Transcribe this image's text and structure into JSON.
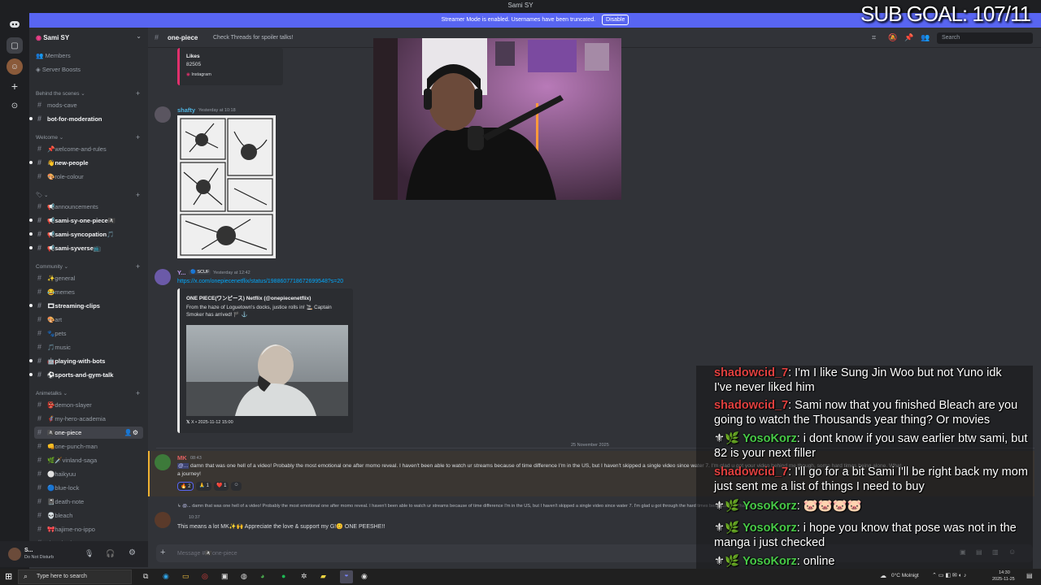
{
  "window": {
    "title": "Sami SY"
  },
  "banner": {
    "text": "Streamer Mode is enabled. Usernames have been truncated.",
    "disable_label": "Disable"
  },
  "overlay": {
    "sub_goal": "SUB GOAL: 107/11"
  },
  "server": {
    "name": "Sami SY"
  },
  "nav": {
    "members": "Members",
    "boosts": "Server Boosts"
  },
  "categories": {
    "behind": "Behind the scenes",
    "welcome": "Welcome",
    "emoji": "🏷 ⌄",
    "community": "Community",
    "animetalks": "Animetalks"
  },
  "channels": {
    "c1": "mods-cave",
    "c2": "bot-for-moderation",
    "c3": "📌welcome-and-rules",
    "c4": "👋new-people",
    "c5": "🎨role-colour",
    "c6": "📢announcements",
    "c7": "📢sami-sy-one-piece🏴‍☠️",
    "c8": "📢sami-syncopation🎵",
    "c9": "📢sami-syverse📺",
    "c10": "✨general",
    "c11": "😂memes",
    "c12": "🎞streaming-clips",
    "c13": "🎨art",
    "c14": "🐾pets",
    "c15": "🎵music",
    "c16": "🤖playing-with-bots",
    "c17": "⚽sports-and-gym-talk",
    "c18": "👺demon-slayer",
    "c19": "🦸my-hero-academia",
    "c20": "🏴‍☠️one-piece",
    "c21": "👊one-punch-man",
    "c22": "🌿🗡️vinland-saga",
    "c23": "⚪haikyuu",
    "c24": "🔵blue-lock",
    "c25": "📓death-note",
    "c26": "💀bleach",
    "c27": "🎀hajime-no-ippo",
    "c28": "dan-da-dan"
  },
  "user": {
    "name": "S...",
    "status": "Do Not Disturb"
  },
  "header": {
    "channel": "one-piece",
    "topic": "Check Threads for spoiler talks!",
    "search_placeholder": "Search"
  },
  "embed_top": {
    "label": "Likes",
    "value": "82505",
    "source": "Instagram"
  },
  "messages": {
    "m1_author": "shafty",
    "m1_time": "Yesterday at 10:18",
    "m2_author": "Y...",
    "m2_tag": "🔵 SCUF",
    "m2_time": "Yesterday at 12:42",
    "m2_link": "https://x.com/onepiecenetflix/status/1988607718672699548?s=20",
    "embed_title": "ONE PIECE(ワンピース) Netflix (@onepiecenetflix)",
    "embed_desc1": "From the haze of Loguetown's docks, justice rolls in! 🚬 Captain",
    "embed_desc2": "Smoker has arrived! 🏴 ⚓",
    "embed_footer": "X • 2025-11-12 15:00",
    "divider_date": "25 November 2025",
    "m3_author": "MK",
    "m3_time": "08:43",
    "m3_text1": "damn that was one hell of a video! Probably the most emotional one after momo reveal. I haven't been able to watch ur streams because of time difference I'm in the US, but I haven't skipped a single video since water 7. I'm glad u got your video behind me though, some hard times being alone. What",
    "m3_text2": "a journey!",
    "r1": "2",
    "r2": "1",
    "r3": "1",
    "m4_reply": "damn that was one hell of a video! Probably the most emotional one after momo reveal. I haven't been able to watch ur streams because of time difference I'm in the US, but I haven't skipped a single video since water 7. I'm glad u got through the hard times being alone. What a journey!",
    "m4_time": "10:37",
    "m4_text": "This means a lot MK✨🙌 Appreciate the love & support my G!😊 ONE PEESHE!!"
  },
  "composer": {
    "placeholder": "Message #🏴‍☠️one-piece"
  },
  "chat": {
    "l0": "I'm I like Sung Jin Woo but not Yuno idk",
    "l1": "I've never liked him",
    "l2_name": "shadowcid_7",
    "l2_text": "Sami now that you finished Bleach are you going to watch the Thousands year thing? Or movies",
    "l3_name": "YosoKorz",
    "l3_text": "i dont know if you saw earlier btw sami, but 82 is your next filler",
    "l4_name": "shadowcid_7",
    "l4_text": "I'll go for a bit Sami I'll be right back my mom just sent me a list of things I need to buy",
    "l5_name": "YosoKorz",
    "l5_text": "🐷🐷🐷🐷",
    "l6_name": "YosoKorz",
    "l6_text": "i hope you know that pose was not in the manga i just checked",
    "l7_name": "YosoKorz",
    "l7_text": "online"
  },
  "taskbar": {
    "search": "Type here to search",
    "weather": "0°C  Molnigt",
    "time": "14:30",
    "date": "2025-11-25"
  }
}
